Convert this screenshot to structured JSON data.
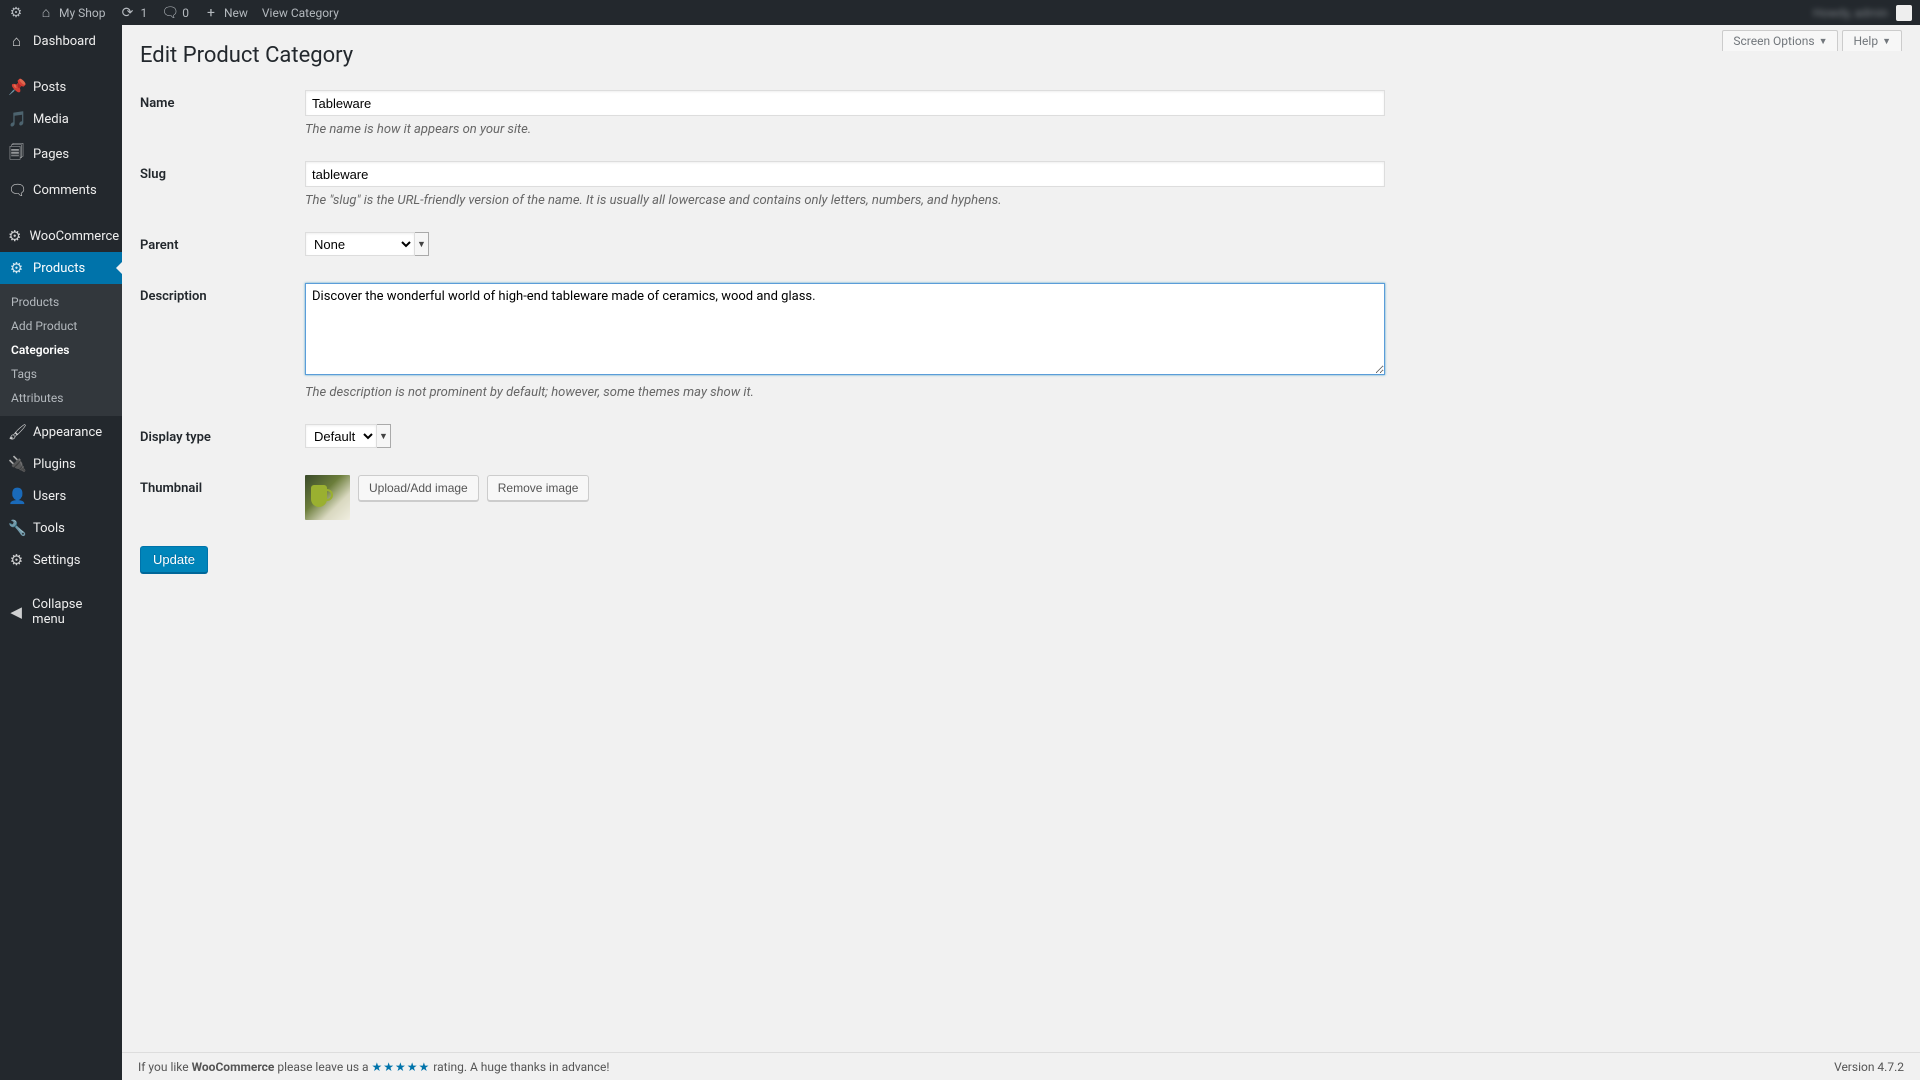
{
  "adminBar": {
    "site": "My Shop",
    "updates": "1",
    "comments": "0",
    "new": "New",
    "view": "View Category"
  },
  "sidebar": {
    "items": [
      {
        "icon": "dashboard",
        "label": "Dashboard"
      },
      {
        "icon": "pin",
        "label": "Posts"
      },
      {
        "icon": "media",
        "label": "Media"
      },
      {
        "icon": "page",
        "label": "Pages"
      },
      {
        "icon": "comment",
        "label": "Comments"
      },
      {
        "icon": "woo",
        "label": "WooCommerce"
      },
      {
        "icon": "product",
        "label": "Products"
      },
      {
        "icon": "appearance",
        "label": "Appearance"
      },
      {
        "icon": "plugin",
        "label": "Plugins"
      },
      {
        "icon": "users",
        "label": "Users"
      },
      {
        "icon": "tools",
        "label": "Tools"
      },
      {
        "icon": "settings",
        "label": "Settings"
      },
      {
        "icon": "collapse",
        "label": "Collapse menu"
      }
    ],
    "submenu": [
      "Products",
      "Add Product",
      "Categories",
      "Tags",
      "Attributes"
    ]
  },
  "tabs": {
    "screen": "Screen Options",
    "help": "Help"
  },
  "page": {
    "title": "Edit Product Category",
    "fields": {
      "name": {
        "label": "Name",
        "value": "Tableware",
        "help": "The name is how it appears on your site."
      },
      "slug": {
        "label": "Slug",
        "value": "tableware",
        "help": "The \"slug\" is the URL-friendly version of the name. It is usually all lowercase and contains only letters, numbers, and hyphens."
      },
      "parent": {
        "label": "Parent",
        "value": "None"
      },
      "description": {
        "label": "Description",
        "value": "Discover the wonderful world of high-end tableware made of ceramics, wood and glass.",
        "help": "The description is not prominent by default; however, some themes may show it."
      },
      "display": {
        "label": "Display type",
        "value": "Default"
      },
      "thumbnail": {
        "label": "Thumbnail",
        "upload": "Upload/Add image",
        "remove": "Remove image"
      }
    },
    "submit": "Update"
  },
  "footer": {
    "pre": "If you like ",
    "brand": "WooCommerce",
    "mid": " please leave us a ",
    "stars": "★★★★★",
    "post": " rating. A huge thanks in advance!",
    "version": "Version 4.7.2"
  }
}
